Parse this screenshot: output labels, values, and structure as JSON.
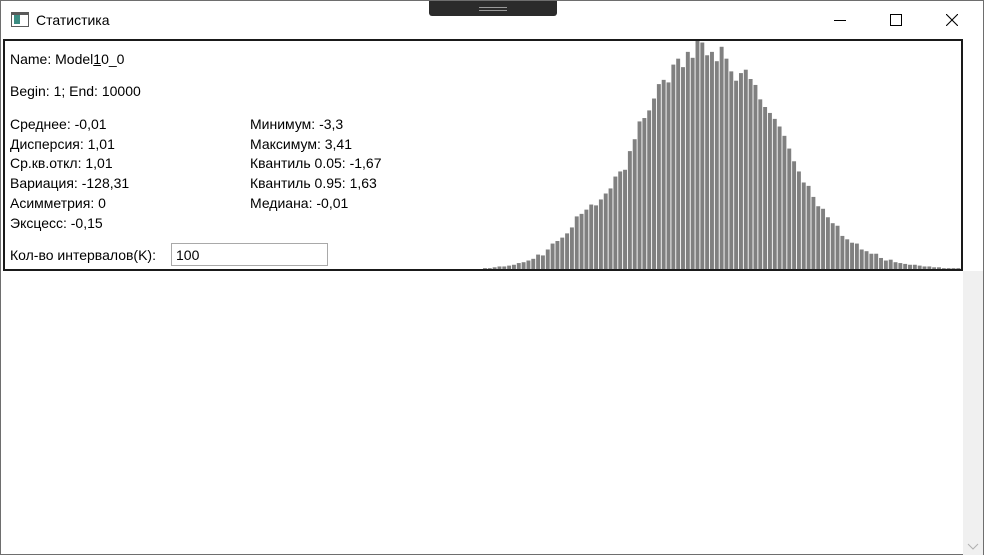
{
  "window": {
    "title": "Статистика"
  },
  "model": {
    "name_prefix": "Name: Model",
    "name_underlined": "1",
    "name_suffix": "0_0",
    "range": "Begin: 1; End: 10000"
  },
  "stats_left": [
    "Среднее: -0,01",
    "Дисперсия: 1,01",
    "Ср.кв.откл: 1,01",
    "Вариация: -128,31",
    "Асимметрия: 0",
    "Эксцесс: -0,15"
  ],
  "stats_right": [
    "Минимум: -3,3",
    "Максимум: 3,41",
    "Квантиль 0.05: -1,67",
    "Квантиль 0.95: 1,63",
    "Медиана: -0,01"
  ],
  "intervals": {
    "label": "Кол-во интервалов(K):",
    "value": "100"
  },
  "chart_data": {
    "type": "bar",
    "bar_color": "#808080",
    "values": [
      1,
      1,
      2,
      3,
      3,
      4,
      5,
      7,
      8,
      10,
      12,
      17,
      16,
      23,
      30,
      33,
      37,
      42,
      49,
      62,
      65,
      70,
      76,
      75,
      82,
      89,
      95,
      109,
      115,
      117,
      139,
      153,
      174,
      178,
      187,
      201,
      218,
      223,
      220,
      241,
      248,
      238,
      256,
      249,
      270,
      267,
      252,
      256,
      245,
      262,
      248,
      233,
      222,
      231,
      235,
      224,
      217,
      200,
      191,
      184,
      177,
      168,
      157,
      142,
      127,
      115,
      102,
      98,
      85,
      74,
      71,
      61,
      54,
      51,
      39,
      35,
      31,
      30,
      23,
      21,
      18,
      18,
      13,
      10,
      11,
      8,
      7,
      6,
      5,
      5,
      4,
      3,
      3,
      2,
      2,
      1,
      1,
      1,
      1,
      1
    ]
  }
}
